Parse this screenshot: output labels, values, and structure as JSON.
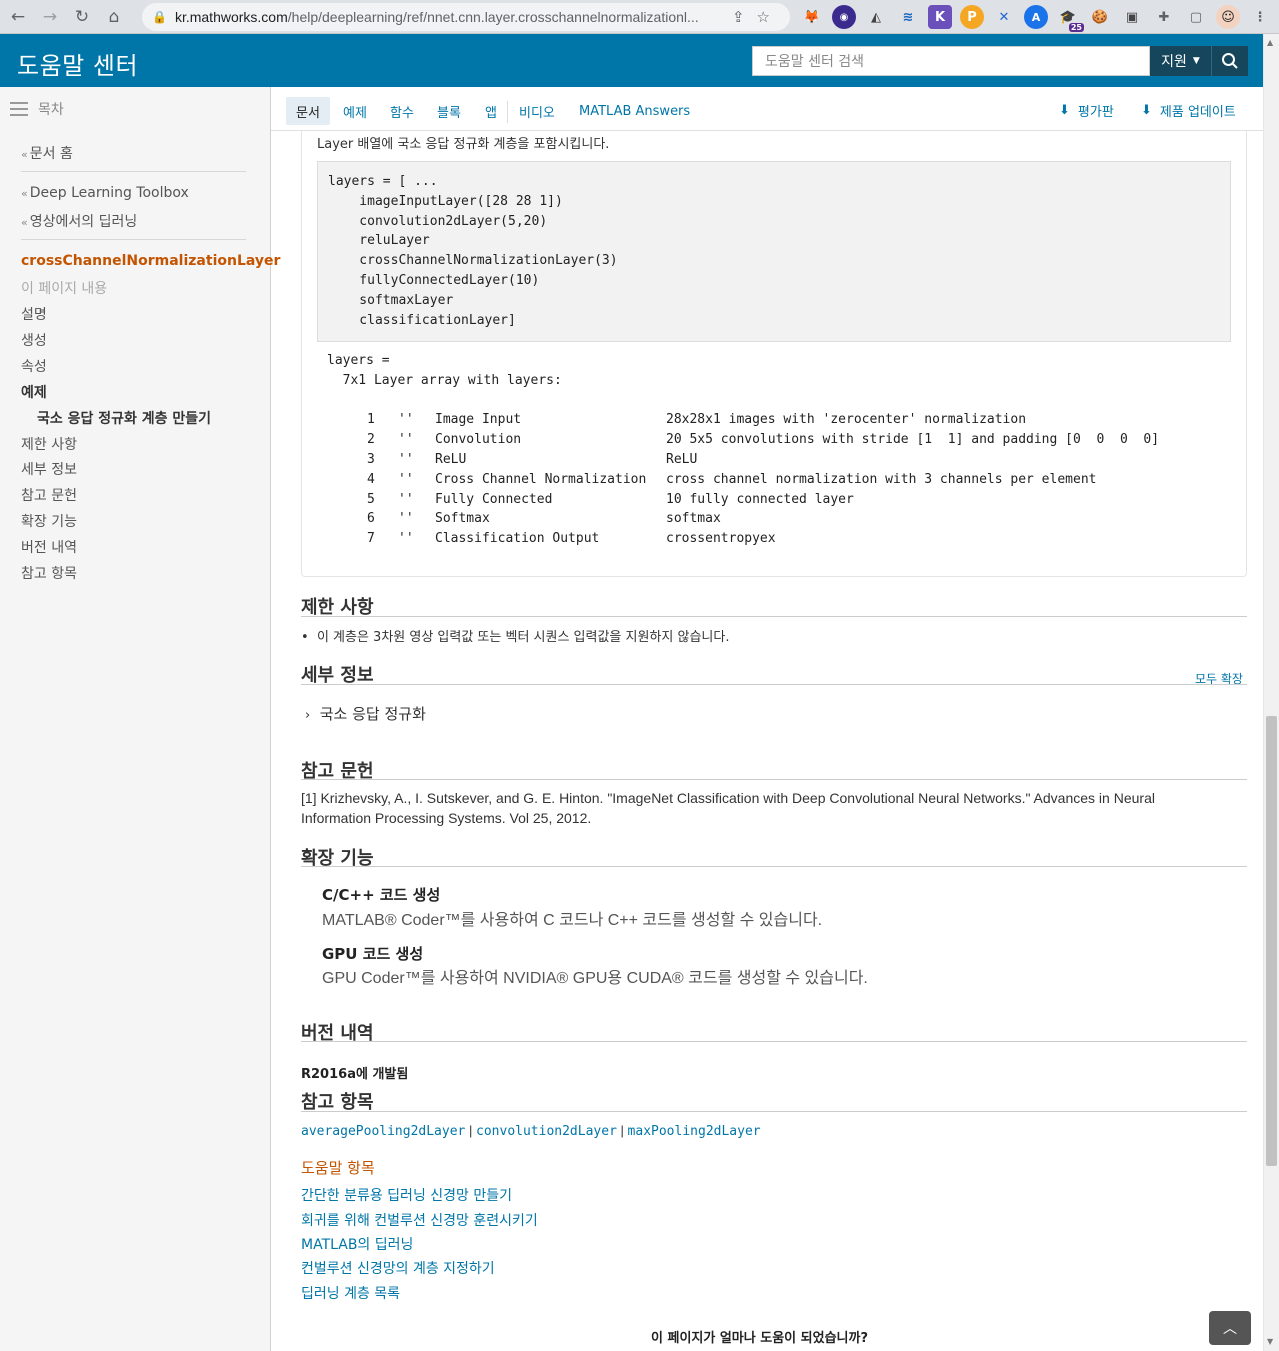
{
  "browser": {
    "url_host": "kr.mathworks.com",
    "url_path": "/help/deeplearning/ref/nnet.cnn.layer.crosschannelnormalizationl...",
    "badge_count": "25"
  },
  "header": {
    "title": "도움말 센터",
    "search_placeholder": "도움말 센터 검색",
    "support_label": "지원"
  },
  "sidebar": {
    "toc_label": "목차",
    "doc_home": "문서 홈",
    "toolbox": "Deep Learning Toolbox",
    "parent": "영상에서의 딥러닝",
    "current": "crossChannelNormalizationLayer",
    "on_this_page": "이 페이지 내용",
    "items": [
      "설명",
      "생성",
      "속성",
      "예제",
      "국소 응답 정규화 계층 만들기",
      "제한 사항",
      "세부 정보",
      "참고 문헌",
      "확장 기능",
      "버전 내역",
      "참고 항목"
    ]
  },
  "tabs": {
    "items": [
      "문서",
      "예제",
      "함수",
      "블록",
      "앱",
      "비디오",
      "MATLAB Answers"
    ],
    "rating": "평가판",
    "updates": "제품 업데이트"
  },
  "example": {
    "intro": "Layer 배열에 국소 응답 정규화 계층을 포함시킵니다.",
    "code": "layers = [ ...\n    imageInputLayer([28 28 1])\n    convolution2dLayer(5,20)\n    reluLayer\n    crossChannelNormalizationLayer(3)\n    fullyConnectedLayer(10)\n    softmaxLayer\n    classificationLayer]",
    "output_line1": "layers = ",
    "output_line2": "  7x1 Layer array with layers:",
    "layers": [
      {
        "idx": "1",
        "q": "''",
        "name": "Image Input",
        "desc": "28x28x1 images with 'zerocenter' normalization"
      },
      {
        "idx": "2",
        "q": "''",
        "name": "Convolution",
        "desc": "20 5x5 convolutions with stride [1  1] and padding [0  0  0  0]"
      },
      {
        "idx": "3",
        "q": "''",
        "name": "ReLU",
        "desc": "ReLU"
      },
      {
        "idx": "4",
        "q": "''",
        "name": "Cross Channel Normalization",
        "desc": "cross channel normalization with 3 channels per element"
      },
      {
        "idx": "5",
        "q": "''",
        "name": "Fully Connected",
        "desc": "10 fully connected layer"
      },
      {
        "idx": "6",
        "q": "''",
        "name": "Softmax",
        "desc": "softmax"
      },
      {
        "idx": "7",
        "q": "''",
        "name": "Classification Output",
        "desc": "crossentropyex"
      }
    ]
  },
  "limitations": {
    "heading": "제한 사항",
    "bullet": "이 계층은 3차원 영상 입력값 또는 벡터 시퀀스 입력값을 지원하지 않습니다."
  },
  "details": {
    "heading": "세부 정보",
    "expand_all": "모두 확장",
    "item": "국소 응답 정규화"
  },
  "references": {
    "heading": "참고 문헌",
    "line1": "[1] Krizhevsky, A., I. Sutskever, and G. E. Hinton. \"ImageNet Classification with Deep Convolutional Neural Networks.\" Advances in Neural",
    "line2": "Information Processing Systems. Vol 25, 2012."
  },
  "extended": {
    "heading": "확장 기능",
    "cpp_title": "C/C++ 코드 생성",
    "cpp_text": "MATLAB® Coder™를 사용하여 C 코드나 C++ 코드를 생성할 수 있습니다.",
    "gpu_title": "GPU 코드 생성",
    "gpu_text": "GPU Coder™를 사용하여 NVIDIA® GPU용 CUDA® 코드를 생성할 수 있습니다."
  },
  "history": {
    "heading": "버전 내역",
    "release": "R2016a",
    "release_suffix": "에 개발됨"
  },
  "see_also": {
    "heading": "참고 항목",
    "functions": [
      "averagePooling2dLayer",
      "convolution2dLayer",
      "maxPooling2dLayer"
    ],
    "sep": "|",
    "topics_heading": "도움말 항목",
    "topics": [
      "간단한 분류용 딥러닝 신경망 만들기",
      "회귀를 위해 컨벌루션 신경망 훈련시키기",
      "MATLAB의 딥러닝",
      "컨벌루션 신경망의 계층 지정하기",
      "딥러닝 계층 목록"
    ]
  },
  "feedback": {
    "question": "이 페이지가 얼마나 도움이 되었습니까?"
  },
  "colors": {
    "brand": "#0076a8",
    "accent_orange": "#c45400"
  }
}
